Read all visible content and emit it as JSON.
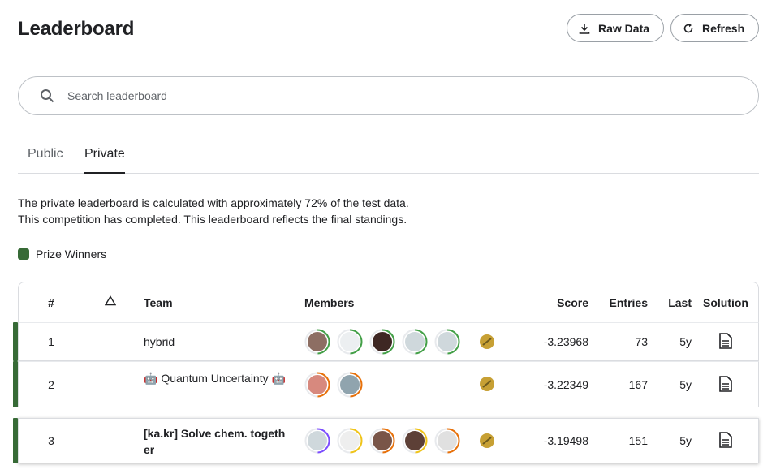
{
  "header": {
    "title": "Leaderboard",
    "raw_data_label": "Raw Data",
    "refresh_label": "Refresh"
  },
  "search": {
    "placeholder": "Search leaderboard"
  },
  "tabs": [
    {
      "label": "Public",
      "active": false
    },
    {
      "label": "Private",
      "active": true
    }
  ],
  "info": {
    "line1": "The private leaderboard is calculated with approximately 72% of the test data.",
    "line2": "This competition has completed. This leaderboard reflects the final standings."
  },
  "legend": {
    "label": "Prize Winners",
    "color": "#376a36"
  },
  "table": {
    "columns": {
      "rank": "#",
      "team": "Team",
      "members": "Members",
      "score": "Score",
      "entries": "Entries",
      "last": "Last",
      "solution": "Solution"
    },
    "rows": [
      {
        "rank": "1",
        "delta": "—",
        "team": "hybrid",
        "score": "-3.23968",
        "entries": "73",
        "last": "5y",
        "members": [
          {
            "ring": "#43a047",
            "bg": "#8d6e63"
          },
          {
            "ring": "#43a047",
            "bg": "#eceff1"
          },
          {
            "ring": "#43a047",
            "bg": "#3e2723"
          },
          {
            "ring": "#43a047",
            "bg": "#cfd8dc"
          },
          {
            "ring": "#43a047",
            "bg": "#cfd8dc"
          }
        ]
      },
      {
        "rank": "2",
        "delta": "—",
        "team": "🤖 Quantum Uncertainty 🤖",
        "score": "-3.22349",
        "entries": "167",
        "last": "5y",
        "members": [
          {
            "ring": "#e8710a",
            "bg": "#d7897e"
          },
          {
            "ring": "#e8710a",
            "bg": "#90a4ae"
          }
        ]
      },
      {
        "rank": "3",
        "delta": "—",
        "team": "[ka.kr] Solve chem. together",
        "score": "-3.19498",
        "entries": "151",
        "last": "5y",
        "members": [
          {
            "ring": "#7c4dff",
            "bg": "#cfd8dc"
          },
          {
            "ring": "#f0c419",
            "bg": "#eeeeee"
          },
          {
            "ring": "#e8710a",
            "bg": "#795548"
          },
          {
            "ring": "#f0c419",
            "bg": "#5d4037"
          },
          {
            "ring": "#e8710a",
            "bg": "#e0e0e0"
          }
        ]
      }
    ]
  },
  "colors": {
    "prize": "#376a36",
    "medal": "#c7a034"
  }
}
